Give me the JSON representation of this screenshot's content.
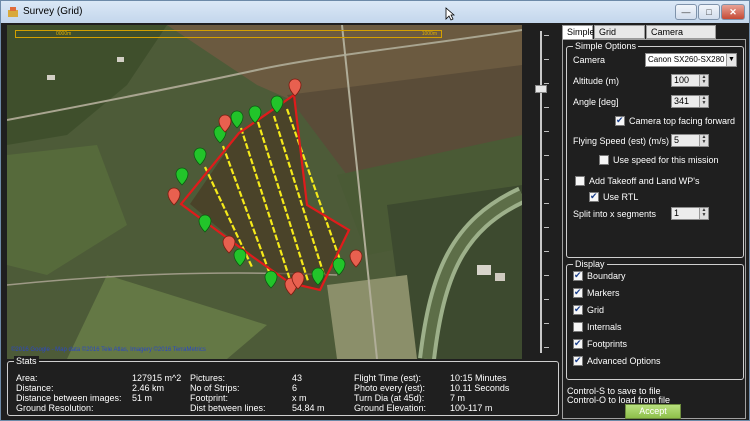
{
  "window": {
    "title": "Survey (Grid)",
    "min_glyph": "—",
    "max_glyph": "□",
    "close_glyph": "✕"
  },
  "map": {
    "scale_start": "0000m",
    "scale_end": "1000m",
    "copyright": "©2016 Google - Map data ©2016 Tele Atlas, Imagery ©2016 TerraMetrics"
  },
  "stats": {
    "legend": "Stats",
    "rows": [
      [
        "Area:",
        "127915 m^2",
        "Pictures:",
        "43",
        "Flight Time (est):",
        "10:15 Minutes"
      ],
      [
        "Distance:",
        "2.46 km",
        "No of Strips:",
        "6",
        "Photo every (est):",
        "10.11 Seconds"
      ],
      [
        "Distance between images:",
        "51 m",
        "Footprint:",
        "x m",
        "Turn Dia (at 45d):",
        "7 m"
      ],
      [
        "Ground Resolution:",
        "",
        "Dist between lines:",
        "54.84 m",
        "Ground Elevation:",
        "100-117 m"
      ]
    ]
  },
  "tabs": [
    "Simple",
    "Grid Options",
    "Camera Config"
  ],
  "simple": {
    "legend": "Simple Options",
    "camera_label": "Camera",
    "camera_value": "Canon SX260-SX280",
    "altitude_label": "Altitude (m)",
    "altitude_value": "100",
    "angle_label": "Angle [deg]",
    "angle_value": "341",
    "camera_top_label": "Camera top facing forward",
    "camera_top_checked": true,
    "speed_label": "Flying Speed (est) (m/s)",
    "speed_value": "5",
    "use_speed_label": "Use speed for this mission",
    "use_speed_checked": false,
    "takeoff_label": "Add Takeoff and Land WP's",
    "takeoff_checked": false,
    "rtl_label": "Use RTL",
    "rtl_checked": true,
    "split_label": "Split into x segments",
    "split_value": "1"
  },
  "display": {
    "legend": "Display",
    "items": [
      {
        "label": "Boundary",
        "checked": true
      },
      {
        "label": "Markers",
        "checked": true
      },
      {
        "label": "Grid",
        "checked": true
      },
      {
        "label": "Internals",
        "checked": false
      },
      {
        "label": "Footprints",
        "checked": true
      },
      {
        "label": "Advanced Options",
        "checked": true
      }
    ]
  },
  "hint_save": "Control-S to save to file",
  "hint_load": "Control-O to load from file",
  "accept_label": "Accept",
  "colors": {
    "boundary": "#e01b1b",
    "grid": "#f5ea1a",
    "marker_green": "#22c42a",
    "marker_red": "#e8604f",
    "accept": "#9ccc5c"
  }
}
